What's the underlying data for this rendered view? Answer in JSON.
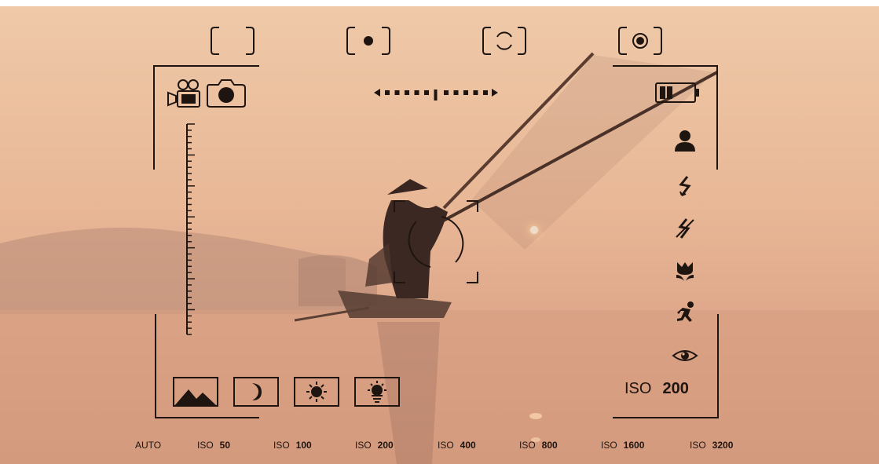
{
  "viewfinder": {
    "metering_modes": [
      "matrix-metering-icon",
      "center-weighted-metering-icon",
      "partial-metering-icon",
      "spot-metering-icon"
    ],
    "capture_modes": [
      "video-camera-icon",
      "photo-camera-icon"
    ],
    "battery": {
      "level_bars": 2,
      "max_bars": 4
    },
    "side_modes": [
      "portrait-icon",
      "flash-auto-icon",
      "flash-off-icon",
      "macro-flower-icon",
      "sports-running-icon",
      "red-eye-icon"
    ],
    "iso_current": {
      "label": "ISO",
      "value": "200"
    },
    "scene_modes": [
      "landscape-icon",
      "night-icon",
      "sunny-icon",
      "brightness-icon"
    ]
  },
  "iso_bar": {
    "auto_label": "AUTO",
    "items": [
      {
        "label": "ISO",
        "value": "50"
      },
      {
        "label": "ISO",
        "value": "100"
      },
      {
        "label": "ISO",
        "value": "200"
      },
      {
        "label": "ISO",
        "value": "400"
      },
      {
        "label": "ISO",
        "value": "800"
      },
      {
        "label": "ISO",
        "value": "1600"
      },
      {
        "label": "ISO",
        "value": "3200"
      }
    ]
  },
  "colors": {
    "overlay": "#1e1510",
    "sky_top": "#edc4a3",
    "sky_mid": "#e8b896",
    "water": "#d49a7c"
  }
}
